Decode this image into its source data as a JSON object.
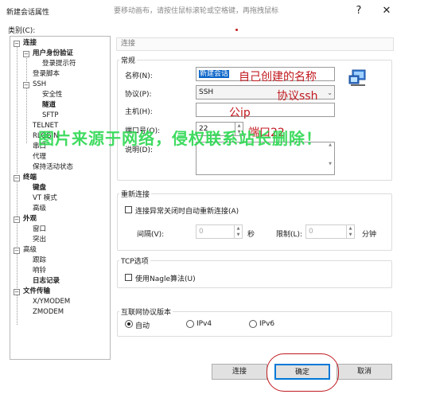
{
  "window": {
    "title": "新建会话属性",
    "hint": "要移动画布，请按住鼠标滚轮或空格键，再拖拽鼠标",
    "help_label": "?",
    "close_label": "✕"
  },
  "category_label": "类别(C):",
  "tree": {
    "items": [
      {
        "label": "连接",
        "bold": true
      },
      {
        "label": "用户身份验证",
        "bold": true
      },
      {
        "label": "登录提示符",
        "bold": false
      },
      {
        "label": "登录脚本",
        "bold": false
      },
      {
        "label": "SSH",
        "bold": false
      },
      {
        "label": "安全性",
        "bold": false
      },
      {
        "label": "隧道",
        "bold": true
      },
      {
        "label": "SFTP",
        "bold": false
      },
      {
        "label": "TELNET",
        "bold": false
      },
      {
        "label": "RLOGIN",
        "bold": false
      },
      {
        "label": "串口",
        "bold": false
      },
      {
        "label": "代理",
        "bold": false
      },
      {
        "label": "保持活动状态",
        "bold": false
      },
      {
        "label": "终端",
        "bold": true
      },
      {
        "label": "键盘",
        "bold": true
      },
      {
        "label": "VT 模式",
        "bold": false
      },
      {
        "label": "高级",
        "bold": false
      },
      {
        "label": "外观",
        "bold": true
      },
      {
        "label": "窗口",
        "bold": false
      },
      {
        "label": "突出",
        "bold": false
      },
      {
        "label": "高级",
        "bold": false
      },
      {
        "label": "跟踪",
        "bold": false
      },
      {
        "label": "响铃",
        "bold": false
      },
      {
        "label": "日志记录",
        "bold": true
      },
      {
        "label": "文件传输",
        "bold": true
      },
      {
        "label": "X/YMODEM",
        "bold": false
      },
      {
        "label": "ZMODEM",
        "bold": false
      }
    ]
  },
  "header": "连接",
  "general": {
    "group_label": "常规",
    "name_label": "名称(N):",
    "name_value": "新建会话",
    "protocol_label": "协议(P):",
    "protocol_value": "SSH",
    "host_label": "主机(H):",
    "host_value": "",
    "port_label": "端口号(O):",
    "port_value": "22",
    "desc_label": "说明(D):",
    "desc_value": ""
  },
  "reconnect": {
    "group_label": "重新连接",
    "checkbox_label": "连接异常关闭时自动重新连接(A)",
    "interval_label": "间隔(V):",
    "interval_value": "0",
    "interval_unit": "秒",
    "limit_label": "限制(L):",
    "limit_value": "0",
    "limit_unit": "分钟"
  },
  "tcp": {
    "group_label": "TCP选项",
    "nagle_label": "使用Nagle算法(U)"
  },
  "ip_version": {
    "group_label": "互联网协议版本",
    "options": [
      "自动",
      "IPv4",
      "IPv6"
    ],
    "selected": "自动"
  },
  "buttons": {
    "connect": "连接",
    "ok": "确定",
    "cancel": "取消"
  },
  "annotations": {
    "name_note": "自己创建的名称",
    "protocol_note": "协议ssh",
    "host_note": "公ip",
    "port_note": "端口22",
    "watermark": "图片来源于网络，侵权联系站长删除！",
    "color": "#c0191f",
    "watermark_color": "#2bd84f"
  }
}
